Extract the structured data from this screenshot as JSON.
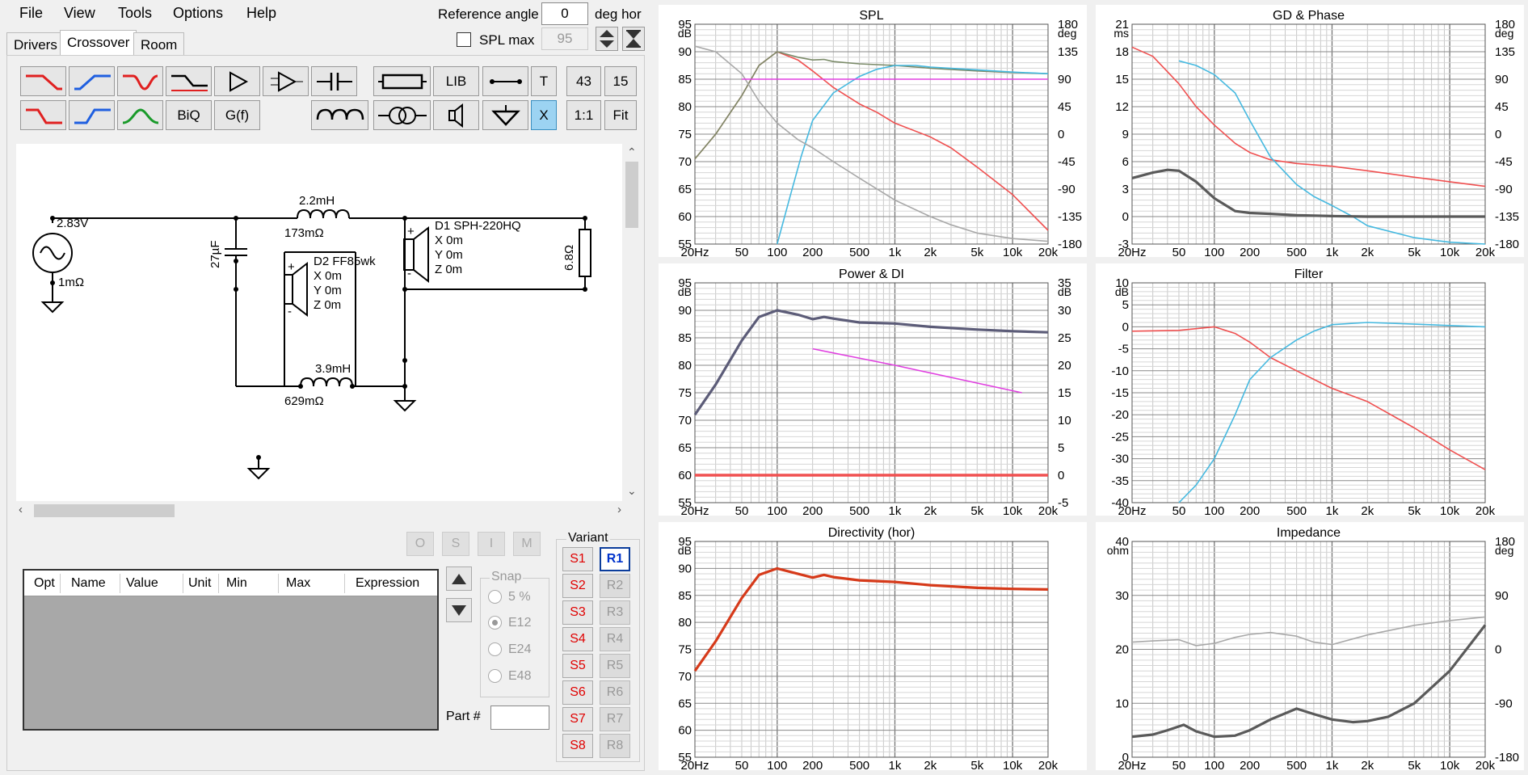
{
  "menu": {
    "file": "File",
    "view": "View",
    "tools": "Tools",
    "options": "Options",
    "help": "Help"
  },
  "ref": {
    "label": "Reference angle",
    "value": "0",
    "unit": "deg hor",
    "spl_max_label": "SPL max",
    "spl_max_value": "95"
  },
  "tabs": {
    "drivers": "Drivers",
    "crossover": "Crossover",
    "room": "Room"
  },
  "toolbar": {
    "lib": "LIB",
    "t": "T",
    "n43": "43",
    "n15": "15",
    "biq": "BiQ",
    "gf": "G(f)",
    "x": "X",
    "ratio": "1:1",
    "fit": "Fit"
  },
  "schematic": {
    "source_v": "2.83V",
    "source_r": "1mΩ",
    "l1_val": "2.2mH",
    "l1_r": "173mΩ",
    "c1": "27µF",
    "l2_val": "3.9mH",
    "l2_r": "629mΩ",
    "r1": "6.8Ω",
    "d1_name": "D1 SPH-220HQ",
    "d1_x": "X 0m",
    "d1_y": "Y 0m",
    "d1_z": "Z 0m",
    "d2_name": "D2 FF85wk",
    "d2_x": "X 0m",
    "d2_y": "Y 0m",
    "d2_z": "Z 0m"
  },
  "opt": {
    "btn_o": "O",
    "btn_s": "S",
    "btn_i": "I",
    "btn_m": "M",
    "headers": [
      "Opt",
      "Name",
      "Value",
      "Unit",
      "Min",
      "Max",
      "Expression"
    ]
  },
  "snap": {
    "label": "Snap",
    "options": [
      "5 %",
      "E12",
      "E24",
      "E48"
    ],
    "selected": "E12",
    "part_label": "Part #",
    "part_value": ""
  },
  "variant": {
    "label": "Variant",
    "s": [
      "S1",
      "S2",
      "S3",
      "S4",
      "S5",
      "S6",
      "S7",
      "S8"
    ],
    "r": [
      "R1",
      "R2",
      "R3",
      "R4",
      "R5",
      "R6",
      "R7",
      "R8"
    ],
    "selected": "R1"
  },
  "colors": {
    "red": "#f05050",
    "blue": "#45b9e0",
    "gray": "#a8a8a8",
    "dark": "#5a5a5a",
    "magenta": "#e040e0",
    "navy": "#5c5c78",
    "orange": "#d63a1a",
    "olive": "#7a8a68"
  },
  "x_ticks": [
    "20Hz",
    "50",
    "100",
    "200",
    "500",
    "1k",
    "2k",
    "5k",
    "10k",
    "20k"
  ],
  "chart_data": [
    {
      "title": "SPL",
      "type": "line",
      "y_unit": "dB",
      "y_ticks": [
        "95",
        "90",
        "85",
        "80",
        "75",
        "70",
        "65",
        "60",
        "55"
      ],
      "ylim": [
        55,
        95
      ],
      "y2_unit": "deg",
      "y2_ticks": [
        "180",
        "135",
        "90",
        "45",
        "0",
        "-45",
        "-90",
        "-135",
        "-180"
      ],
      "y2lim": [
        -180,
        180
      ],
      "series": [
        {
          "color": "red",
          "axis": "left",
          "x": [
            20,
            30,
            50,
            70,
            100,
            150,
            200,
            300,
            500,
            700,
            1000,
            2000,
            3000,
            5000,
            10000,
            20000
          ],
          "y": [
            70.5,
            75,
            82,
            87.5,
            90,
            88.5,
            86.5,
            83.5,
            80.5,
            79,
            77,
            74.5,
            72.5,
            69,
            64,
            57.5
          ]
        },
        {
          "color": "olive",
          "axis": "left",
          "x": [
            20,
            30,
            50,
            70,
            100,
            150,
            200,
            250,
            300,
            500,
            1000,
            2000,
            5000,
            10000,
            20000
          ],
          "y": [
            70.5,
            75,
            82,
            87.5,
            90,
            89,
            88.5,
            88.6,
            88.2,
            87.8,
            87.5,
            87,
            86.5,
            86.2,
            86
          ]
        },
        {
          "color": "blue",
          "axis": "left",
          "x": [
            100,
            130,
            160,
            200,
            300,
            500,
            700,
            1000,
            1500,
            2000,
            5000,
            10000,
            20000
          ],
          "y": [
            55,
            64,
            71,
            77.5,
            82.5,
            85.5,
            86.8,
            87.5,
            87.5,
            87.2,
            86.7,
            86.3,
            86
          ]
        },
        {
          "color": "gray",
          "axis": "left",
          "x": [
            20,
            30,
            50,
            70,
            100,
            150,
            200,
            300,
            500,
            1000,
            2000,
            3000,
            5000,
            10000,
            20000
          ],
          "y": [
            91,
            90,
            86,
            81,
            77,
            74,
            72.5,
            70,
            67,
            63,
            60,
            58.5,
            57,
            56,
            55.5
          ]
        },
        {
          "color": "magenta",
          "axis": "left",
          "x": [
            50,
            20000
          ],
          "y": [
            85,
            85
          ]
        }
      ]
    },
    {
      "title": "GD & Phase",
      "type": "line",
      "y_unit": "ms",
      "y_ticks": [
        "21",
        "18",
        "15",
        "12",
        "9",
        "6",
        "3",
        "0",
        "-3"
      ],
      "ylim": [
        -3,
        21
      ],
      "y2_unit": "deg",
      "y2_ticks": [
        "180",
        "135",
        "90",
        "45",
        "0",
        "-45",
        "-90",
        "-135",
        "-180"
      ],
      "y2lim": [
        -180,
        180
      ],
      "series": [
        {
          "color": "red",
          "axis": "left",
          "x": [
            20,
            30,
            50,
            70,
            100,
            150,
            200,
            300,
            500,
            1000,
            2000,
            5000,
            10000,
            20000
          ],
          "y": [
            18.5,
            17.5,
            14.5,
            12,
            10,
            8,
            7,
            6.2,
            5.8,
            5.5,
            5,
            4.3,
            3.8,
            3.3
          ]
        },
        {
          "color": "blue",
          "axis": "left",
          "x": [
            50,
            70,
            100,
            150,
            200,
            300,
            500,
            700,
            1000,
            1500,
            2000,
            5000,
            10000,
            20000
          ],
          "y": [
            17,
            16.5,
            15.5,
            13.5,
            10.5,
            6.5,
            3.5,
            2.2,
            1.2,
            0,
            -1,
            -2.3,
            -2.8,
            -3
          ]
        },
        {
          "color": "dark",
          "axis": "left",
          "x": [
            20,
            30,
            40,
            50,
            70,
            100,
            150,
            200,
            300,
            500,
            1000,
            2000,
            5000,
            20000
          ],
          "y": [
            4.2,
            4.8,
            5.1,
            5,
            3.8,
            2,
            0.6,
            0.4,
            0.3,
            0.15,
            0.05,
            0,
            0,
            0
          ]
        }
      ]
    },
    {
      "title": "Power & DI",
      "type": "line",
      "y_unit": "dB",
      "y_ticks": [
        "95",
        "90",
        "85",
        "80",
        "75",
        "70",
        "65",
        "60",
        "55"
      ],
      "ylim": [
        55,
        95
      ],
      "y2_unit": "dB",
      "y2_ticks": [
        "35",
        "30",
        "25",
        "20",
        "15",
        "10",
        "5",
        "0",
        "-5"
      ],
      "y2lim": [
        -5,
        35
      ],
      "series": [
        {
          "color": "navy",
          "axis": "left",
          "x": [
            20,
            30,
            50,
            70,
            100,
            150,
            200,
            250,
            300,
            500,
            1000,
            2000,
            5000,
            10000,
            20000
          ],
          "y": [
            71,
            76.5,
            84.5,
            88.8,
            90,
            89.2,
            88.4,
            88.8,
            88.5,
            87.8,
            87.6,
            87,
            86.5,
            86.2,
            86
          ]
        },
        {
          "color": "magenta",
          "axis": "right",
          "x": [
            200,
            1000,
            12000
          ],
          "y": [
            23,
            20,
            15
          ]
        },
        {
          "color": "red",
          "axis": "right",
          "x": [
            20,
            20000
          ],
          "y": [
            0,
            0
          ]
        }
      ]
    },
    {
      "title": "Filter",
      "type": "line",
      "y_unit": "dB",
      "y_ticks": [
        "10",
        "5",
        "0",
        "-5",
        "-10",
        "-15",
        "-20",
        "-25",
        "-30",
        "-35",
        "-40"
      ],
      "ylim": [
        -40,
        10
      ],
      "series": [
        {
          "color": "red",
          "axis": "left",
          "x": [
            20,
            50,
            100,
            150,
            200,
            300,
            500,
            1000,
            2000,
            5000,
            10000,
            20000
          ],
          "y": [
            -1,
            -0.8,
            0,
            -1.5,
            -3.5,
            -7,
            -10,
            -14,
            -17,
            -23,
            -28,
            -32.5
          ]
        },
        {
          "color": "blue",
          "axis": "left",
          "x": [
            50,
            70,
            100,
            150,
            200,
            300,
            500,
            700,
            1000,
            2000,
            5000,
            10000,
            20000
          ],
          "y": [
            -40,
            -36,
            -30,
            -20,
            -12,
            -7,
            -3,
            -1,
            0.5,
            1,
            0.6,
            0.3,
            0
          ]
        }
      ]
    },
    {
      "title": "Directivity (hor)",
      "type": "line",
      "y_unit": "dB",
      "y_ticks": [
        "95",
        "90",
        "85",
        "80",
        "75",
        "70",
        "65",
        "60",
        "55"
      ],
      "ylim": [
        55,
        95
      ],
      "series": [
        {
          "color": "orange",
          "axis": "left",
          "x": [
            20,
            30,
            50,
            70,
            100,
            150,
            200,
            250,
            300,
            500,
            1000,
            2000,
            5000,
            10000,
            20000
          ],
          "y": [
            71,
            76.5,
            84.5,
            88.8,
            90,
            89,
            88.3,
            88.8,
            88.4,
            87.8,
            87.5,
            86.9,
            86.4,
            86.2,
            86.1
          ]
        }
      ]
    },
    {
      "title": "Impedance",
      "type": "line",
      "y_unit": "ohm",
      "y_ticks": [
        "40",
        "30",
        "20",
        "10",
        "0"
      ],
      "ylim": [
        0,
        40
      ],
      "y2_unit": "deg",
      "y2_ticks": [
        "180",
        "90",
        "0",
        "-90",
        "-180"
      ],
      "y2lim": [
        -180,
        180
      ],
      "series": [
        {
          "color": "dark",
          "axis": "left",
          "x": [
            20,
            30,
            40,
            55,
            70,
            100,
            150,
            200,
            300,
            500,
            700,
            1000,
            1500,
            2000,
            3000,
            5000,
            10000,
            20000
          ],
          "y": [
            3.8,
            4.2,
            5,
            6,
            4.8,
            3.8,
            4,
            5,
            7,
            9,
            8,
            7,
            6.5,
            6.7,
            7.5,
            10,
            16,
            24.5
          ]
        },
        {
          "color": "gray",
          "axis": "right",
          "x": [
            20,
            30,
            50,
            70,
            100,
            150,
            200,
            300,
            500,
            700,
            1000,
            2000,
            5000,
            10000,
            20000
          ],
          "y": [
            12,
            14,
            16,
            6,
            10,
            20,
            25,
            28,
            22,
            12,
            8,
            24,
            40,
            48,
            54
          ]
        }
      ]
    }
  ]
}
